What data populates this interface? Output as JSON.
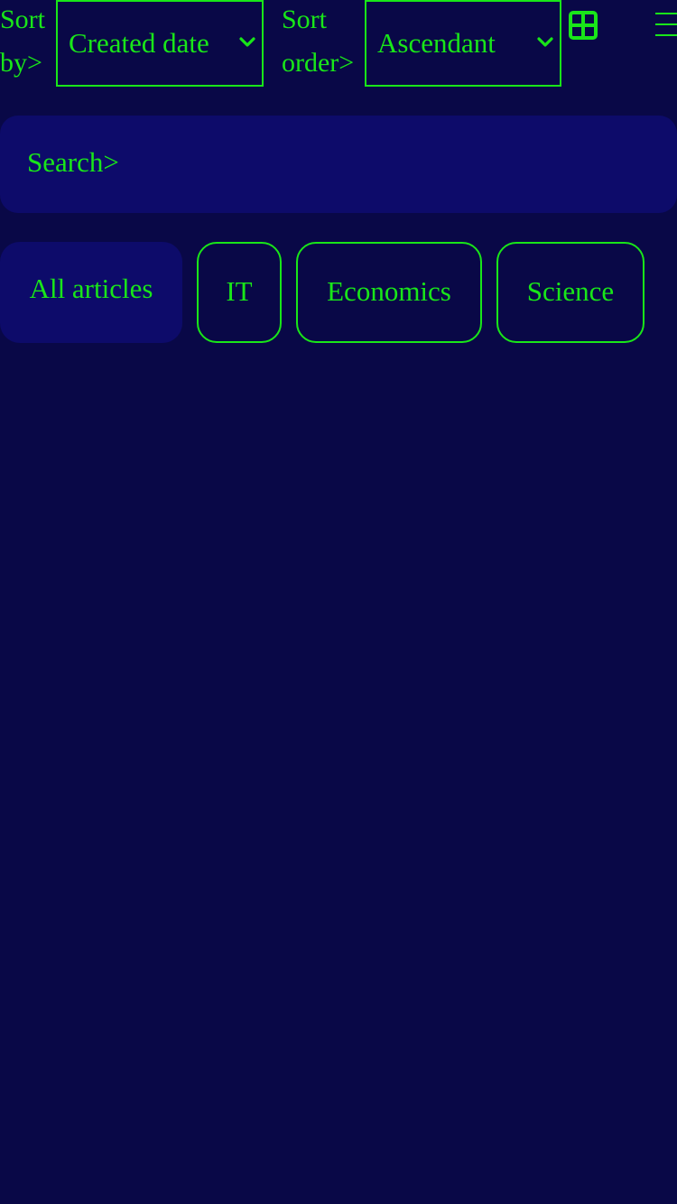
{
  "toolbar": {
    "sort_by": {
      "label_line1": "Sort",
      "label_line2": "by>",
      "selected": "Created date"
    },
    "sort_order": {
      "label_line1": "Sort",
      "label_line2": "order>",
      "selected": "Ascendant"
    },
    "icons": {
      "view_toggle": "grid-view-icon",
      "menu": "menu-icon"
    }
  },
  "search": {
    "placeholder": "Search>"
  },
  "tabs": [
    {
      "label": "All articles",
      "active": true
    },
    {
      "label": "IT",
      "active": false
    },
    {
      "label": "Economics",
      "active": false
    },
    {
      "label": "Science",
      "active": false
    }
  ],
  "colors": {
    "background": "#090847",
    "surface": "#0d0b6a",
    "accent": "#19e619"
  }
}
